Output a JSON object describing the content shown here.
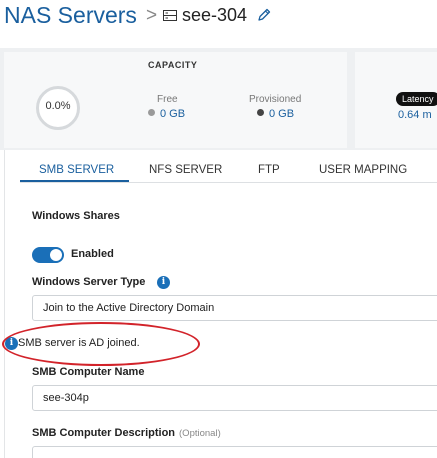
{
  "header": {
    "root": "NAS Servers",
    "separator": ">",
    "current": "see-304"
  },
  "capacity": {
    "title": "CAPACITY",
    "percent": "0.0%",
    "free_label": "Free",
    "free_value": "0 GB",
    "provisioned_label": "Provisioned",
    "provisioned_value": "0 GB",
    "latency_label": "Latency",
    "latency_value": "0.64 m"
  },
  "tabs": [
    {
      "label": "SMB SERVER",
      "active": true
    },
    {
      "label": "NFS SERVER",
      "active": false
    },
    {
      "label": "FTP",
      "active": false
    },
    {
      "label": "USER MAPPING",
      "active": false
    }
  ],
  "smb": {
    "section_title": "Windows Shares",
    "enabled_label": "Enabled",
    "enabled": true,
    "server_type_label": "Windows Server Type",
    "server_type_value": "Join to the Active Directory Domain",
    "note": "SMB server is AD joined.",
    "computer_name_label": "SMB Computer Name",
    "computer_name_value": "see-304p",
    "description_label": "SMB Computer Description",
    "description_optional": "(Optional)",
    "description_value": ""
  },
  "colors": {
    "accent": "#1a5f9e",
    "toggle": "#1a6fb8",
    "annotation": "#d2232a",
    "free_dot": "#9a9a9a",
    "provisioned_dot": "#444444"
  }
}
